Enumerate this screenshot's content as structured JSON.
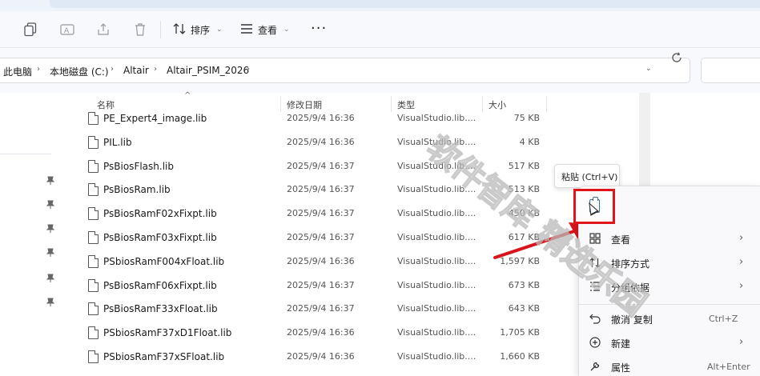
{
  "toolbar": {
    "sort_label": "排序",
    "view_label": "查看",
    "more_label": "···"
  },
  "breadcrumb": [
    "此电脑",
    "本地磁盘 (C:)",
    "Altair",
    "Altair_PSIM_2026"
  ],
  "columns": {
    "name": "名称",
    "modified": "修改日期",
    "type": "类型",
    "size": "大小"
  },
  "files": [
    {
      "name": "PE_Expert4_image.lib",
      "modified": "2025/9/4 16:36",
      "type": "VisualStudio.lib....",
      "size": "75 KB"
    },
    {
      "name": "PIL.lib",
      "modified": "2025/9/4 16:36",
      "type": "VisualStudio.lib....",
      "size": "4 KB"
    },
    {
      "name": "PsBiosFlash.lib",
      "modified": "2025/9/4 16:37",
      "type": "VisualStudio.lib....",
      "size": "517 KB"
    },
    {
      "name": "PsBiosRam.lib",
      "modified": "2025/9/4 16:37",
      "type": "VisualStudio.lib....",
      "size": "513 KB"
    },
    {
      "name": "PsBiosRamF02xFixpt.lib",
      "modified": "2025/9/4 16:37",
      "type": "VisualStudio.lib....",
      "size": "450 KB"
    },
    {
      "name": "PsBiosRamF03xFixpt.lib",
      "modified": "2025/9/4 16:37",
      "type": "VisualStudio.lib....",
      "size": "617 KB"
    },
    {
      "name": "PSbiosRamF004xFloat.lib",
      "modified": "2025/9/4 16:36",
      "type": "VisualStudio.lib....",
      "size": "1,597 KB"
    },
    {
      "name": "PsBiosRamF06xFixpt.lib",
      "modified": "2025/9/4 16:37",
      "type": "VisualStudio.lib....",
      "size": "673 KB"
    },
    {
      "name": "PsBiosRamF33xFloat.lib",
      "modified": "2025/9/4 16:37",
      "type": "VisualStudio.lib....",
      "size": "643 KB"
    },
    {
      "name": "PSbiosRamF37xD1Float.lib",
      "modified": "2025/9/4 16:36",
      "type": "VisualStudio.lib....",
      "size": "1,705 KB"
    },
    {
      "name": "PSbiosRamF37xSFloat.lib",
      "modified": "2025/9/4 16:36",
      "type": "VisualStudio.lib....",
      "size": "1,660 KB"
    }
  ],
  "tooltip": "粘贴 (Ctrl+V)",
  "context_menu": {
    "view": "查看",
    "sort_by": "排序方式",
    "group_by": "分组依据",
    "undo_copy": "撤消 复制",
    "undo_key": "Ctrl+Z",
    "new": "新建",
    "properties": "属性",
    "properties_key": "Alt+Enter"
  },
  "watermark": "软件智库 精选乐园",
  "colors": {
    "highlight_border": "#e0141b",
    "annotation_arrow": "#d9151c",
    "watermark": "#b9b9b9"
  }
}
